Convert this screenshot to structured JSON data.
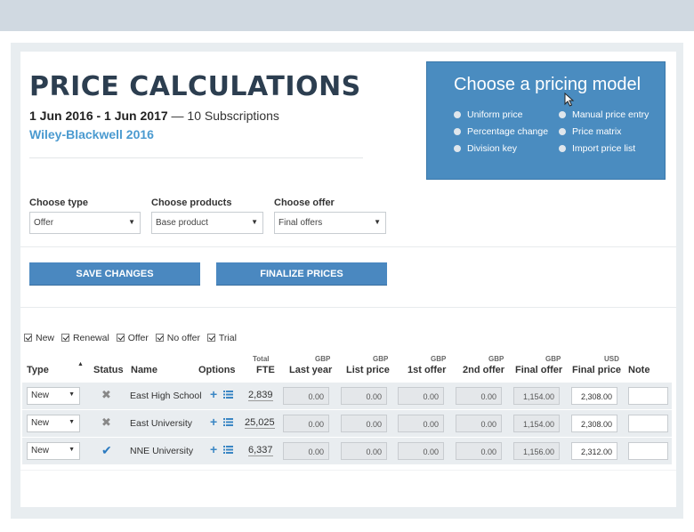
{
  "header": {
    "title": "PRICE CALCULATIONS",
    "date_range": "1 Jun 2016 - 1 Jun 2017",
    "subscriptions": "— 10 Subscriptions",
    "publisher": "Wiley-Blackwell 2016"
  },
  "pricing_model": {
    "title": "Choose a pricing model",
    "options": [
      "Uniform price",
      "Percentage change",
      "Division key",
      "Manual price entry",
      "Price matrix",
      "Import price list"
    ]
  },
  "filters": {
    "type_label": "Choose type",
    "type_value": "Offer",
    "products_label": "Choose products",
    "products_value": "Base product",
    "offer_label": "Choose offer",
    "offer_value": "Final offers"
  },
  "buttons": {
    "save": "SAVE CHANGES",
    "finalize": "FINALIZE PRICES"
  },
  "checkboxes": [
    "New",
    "Renewal",
    "Offer",
    "No offer",
    "Trial"
  ],
  "table": {
    "headers": {
      "type": "Type",
      "status": "Status",
      "name": "Name",
      "options": "Options",
      "fte_top": "Total",
      "fte": "FTE",
      "last_year": "Last year",
      "list_price": "List price",
      "first_offer": "1st offer",
      "second_offer": "2nd offer",
      "final_offer": "Final offer",
      "final_price": "Final price",
      "note": "Note"
    },
    "currencies": {
      "last_year": "GBP",
      "list_price": "GBP",
      "first_offer": "GBP",
      "second_offer": "GBP",
      "final_offer": "GBP",
      "final_price": "USD"
    },
    "rows": [
      {
        "type": "New",
        "status": "✖",
        "name": "East High School",
        "fte": "2,839",
        "last_year": "0.00",
        "list_price": "0.00",
        "first_offer": "0.00",
        "second_offer": "0.00",
        "final_offer": "1,154.00",
        "final_price": "2,308.00"
      },
      {
        "type": "New",
        "status": "✖",
        "name": "East University",
        "fte": "25,025",
        "last_year": "0.00",
        "list_price": "0.00",
        "first_offer": "0.00",
        "second_offer": "0.00",
        "final_offer": "1,154.00",
        "final_price": "2,308.00"
      },
      {
        "type": "New",
        "status": "✔",
        "name": "NNE University",
        "fte": "6,337",
        "last_year": "0.00",
        "list_price": "0.00",
        "first_offer": "0.00",
        "second_offer": "0.00",
        "final_offer": "1,156.00",
        "final_price": "2,312.00"
      }
    ]
  },
  "colors": {
    "accent": "#4a88c0",
    "title": "#2c3e50",
    "publisher": "#4a9ad0"
  }
}
